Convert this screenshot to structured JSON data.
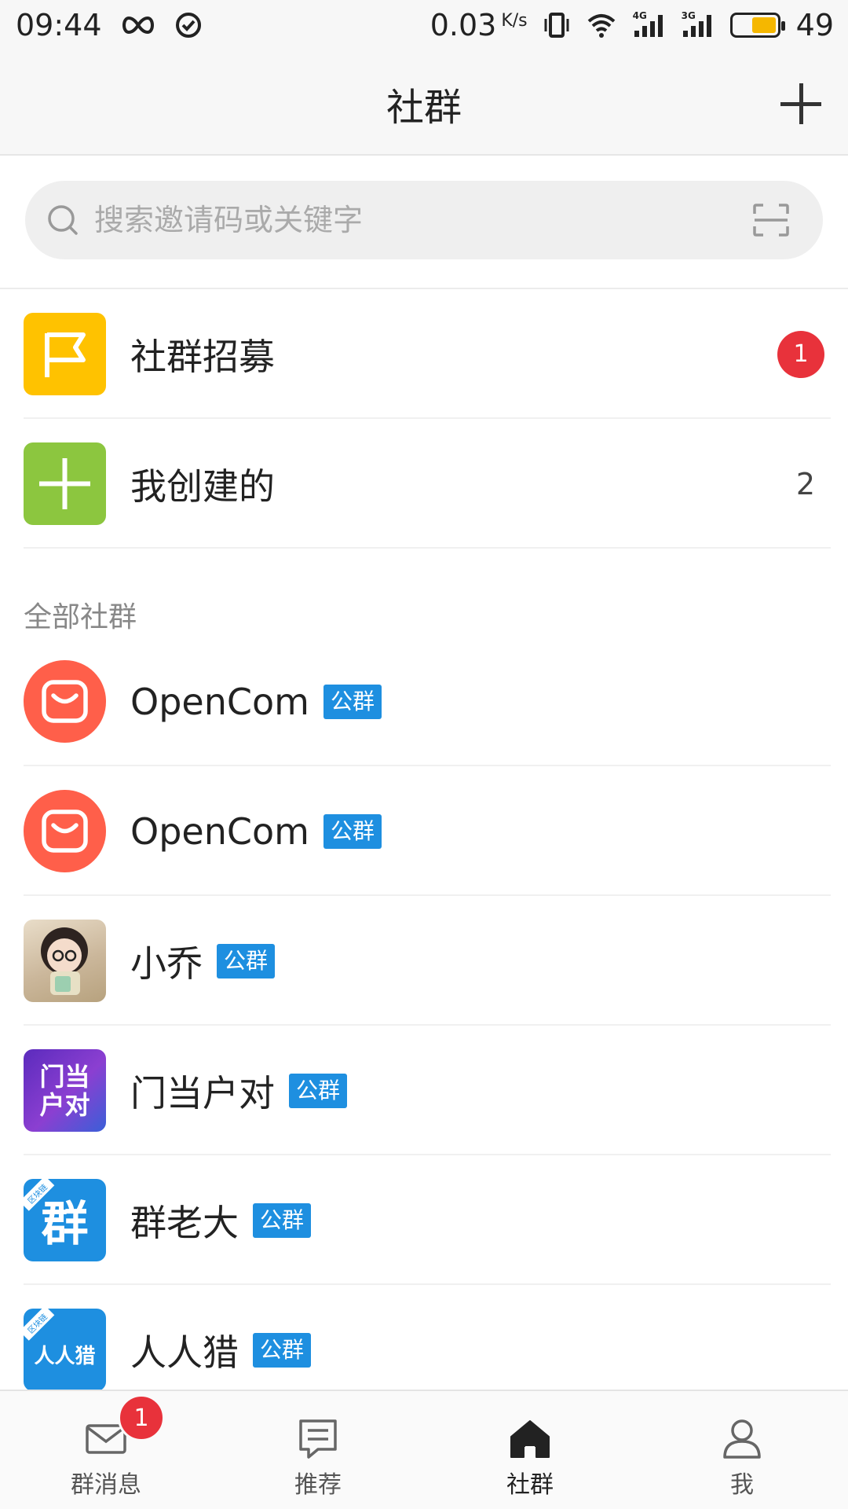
{
  "status_bar": {
    "time": "09:44",
    "speed": "0.03",
    "speed_unit": "K/s",
    "battery_level": "49",
    "signal_1_label": "4G",
    "signal_2_label": "3G"
  },
  "header": {
    "title": "社群",
    "add_icon": "plus-icon"
  },
  "search": {
    "placeholder": "搜索邀请码或关键字",
    "scan_icon": "scan-icon"
  },
  "shortcuts": [
    {
      "label": "社群招募",
      "icon": "flag-icon",
      "color": "#ffc200",
      "badge": "1"
    },
    {
      "label": "我创建的",
      "icon": "plus-icon",
      "color": "#8cc63f",
      "count": "2"
    }
  ],
  "section": {
    "title": "全部社群"
  },
  "public_badge_label": "公群",
  "communities": [
    {
      "name": "OpenCom",
      "icon": "shopping-bag-icon",
      "color": "#ff5f4a"
    },
    {
      "name": "OpenCom",
      "icon": "shopping-bag-icon",
      "color": "#ff5f4a"
    },
    {
      "name": "小乔",
      "icon": "avatar-photo",
      "color": "#d9c4a8"
    },
    {
      "name": "门当户对",
      "icon": "logo-mendanghudui",
      "color": "#7b3fc8",
      "logo_text": "门当户对"
    },
    {
      "name": "群老大",
      "icon": "logo-qunlaoda",
      "color": "#1e8fe0",
      "logo_text": "群",
      "logo_ribbon": "区块链"
    },
    {
      "name": "人人猎",
      "icon": "logo-renrenlie",
      "color": "#1e8fe0",
      "logo_text": "人人猎",
      "logo_ribbon": "区块链"
    }
  ],
  "bottom_nav": [
    {
      "label": "群消息",
      "icon": "mail-icon",
      "badge": "1",
      "active": false
    },
    {
      "label": "推荐",
      "icon": "list-icon",
      "active": false
    },
    {
      "label": "社群",
      "icon": "home-icon",
      "active": true
    },
    {
      "label": "我",
      "icon": "user-icon",
      "active": false
    }
  ],
  "colors": {
    "accent_blue": "#1e8fe0",
    "badge_red": "#e8323b"
  }
}
